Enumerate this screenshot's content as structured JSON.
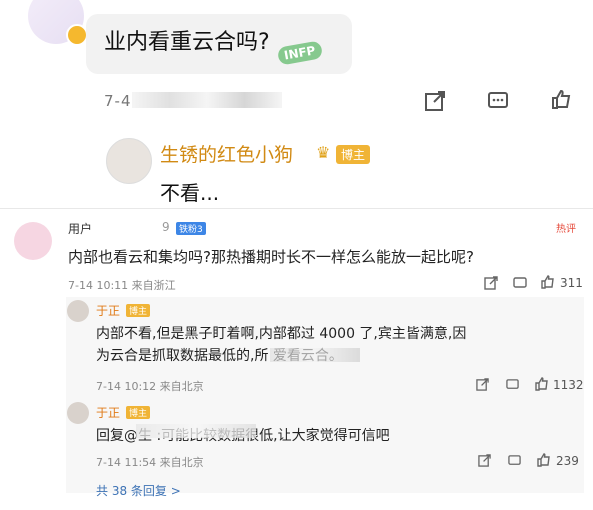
{
  "top": {
    "question": "业内看重云合吗?",
    "sticker": "INFP",
    "meta": "7-4",
    "reply": {
      "username": "生锈的红色小狗",
      "tag": "博主",
      "text": "不看..."
    }
  },
  "comment": {
    "user": "用户",
    "user_suffix": "9",
    "level": "铁粉3",
    "hot": "热评",
    "text": "内部也看云和集均吗?那热播期时长不一样怎么能放一起比呢?",
    "time": "7-14 10:11 来自浙江",
    "likes": "311",
    "replies": [
      {
        "username": "于正",
        "tag": "博主",
        "text_line1": "内部不看,但是黑子盯着啊,内部都过 4000 了,宾主皆满意,因",
        "text_line2": "为云合是抓取数据最低的,所                     爱看云合。",
        "time": "7-14 10:12 来自北京",
        "likes": "1132"
      },
      {
        "username": "于正",
        "tag": "博主",
        "text": "回复@生                  :可能比较数据很低,让大家觉得可信吧",
        "time": "7-14 11:54 来自北京",
        "likes": "239"
      }
    ],
    "more": "共 38 条回复 >"
  },
  "colors": {
    "accent_orange": "#e07a16",
    "link_blue": "#3e73b5",
    "hot_red": "#e64b3c"
  }
}
